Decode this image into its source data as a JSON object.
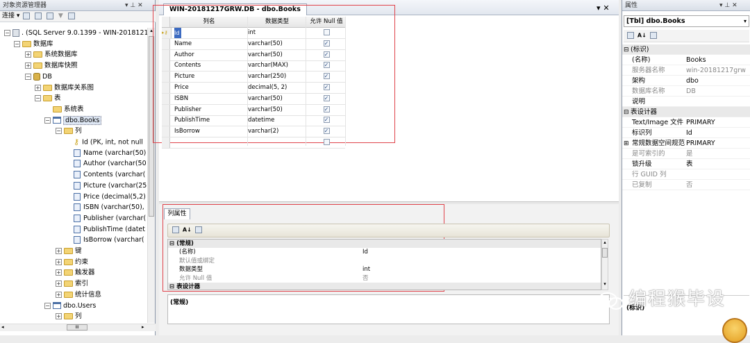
{
  "object_explorer": {
    "title": "对象资源管理器",
    "pin_label": "▾ ⊥ ✕",
    "connect_label": "连接",
    "tree": [
      {
        "label": ". (SQL Server 9.0.1399 - WIN-2018121",
        "level": 0,
        "icon": "server",
        "expander": "minus"
      },
      {
        "label": "数据库",
        "level": 1,
        "icon": "folder",
        "expander": "minus"
      },
      {
        "label": "系统数据库",
        "level": 2,
        "icon": "folder",
        "expander": "plus"
      },
      {
        "label": "数据库快照",
        "level": 2,
        "icon": "folder",
        "expander": "plus"
      },
      {
        "label": "DB",
        "level": 2,
        "icon": "database",
        "expander": "minus"
      },
      {
        "label": "数据库关系图",
        "level": 3,
        "icon": "folder",
        "expander": "plus"
      },
      {
        "label": "表",
        "level": 3,
        "icon": "folder",
        "expander": "minus"
      },
      {
        "label": "系统表",
        "level": 4,
        "icon": "folder",
        "expander": "none"
      },
      {
        "label": "dbo.Books",
        "level": 4,
        "icon": "table",
        "expander": "minus",
        "selected": true
      },
      {
        "label": "列",
        "level": 5,
        "icon": "folder",
        "expander": "minus"
      },
      {
        "label": "Id (PK, int, not null",
        "level": 6,
        "icon": "key",
        "expander": "none"
      },
      {
        "label": "Name (varchar(50)",
        "level": 6,
        "icon": "column",
        "expander": "none"
      },
      {
        "label": "Author (varchar(50",
        "level": 6,
        "icon": "column",
        "expander": "none"
      },
      {
        "label": "Contents (varchar(",
        "level": 6,
        "icon": "column",
        "expander": "none"
      },
      {
        "label": "Picture (varchar(25",
        "level": 6,
        "icon": "column",
        "expander": "none"
      },
      {
        "label": "Price (decimal(5,2)",
        "level": 6,
        "icon": "column",
        "expander": "none"
      },
      {
        "label": "ISBN (varchar(50),",
        "level": 6,
        "icon": "column",
        "expander": "none"
      },
      {
        "label": "Publisher (varchar(",
        "level": 6,
        "icon": "column",
        "expander": "none"
      },
      {
        "label": "PublishTime (datet",
        "level": 6,
        "icon": "column",
        "expander": "none"
      },
      {
        "label": "IsBorrow (varchar(",
        "level": 6,
        "icon": "column",
        "expander": "none"
      },
      {
        "label": "键",
        "level": 5,
        "icon": "folder",
        "expander": "plus"
      },
      {
        "label": "约束",
        "level": 5,
        "icon": "folder",
        "expander": "plus"
      },
      {
        "label": "触发器",
        "level": 5,
        "icon": "folder",
        "expander": "plus"
      },
      {
        "label": "索引",
        "level": 5,
        "icon": "folder",
        "expander": "plus"
      },
      {
        "label": "统计信息",
        "level": 5,
        "icon": "folder",
        "expander": "plus"
      },
      {
        "label": "dbo.Users",
        "level": 4,
        "icon": "table",
        "expander": "minus"
      },
      {
        "label": "列",
        "level": 5,
        "icon": "folder",
        "expander": "plus"
      }
    ],
    "hscroll_label": "III"
  },
  "designer": {
    "tab_label": "WIN-20181217GRW.DB - dbo.Books",
    "close_label": "▾ ✕",
    "headers": {
      "name": "列名",
      "type": "数据类型",
      "null": "允许 Null 值"
    },
    "rows": [
      {
        "name": "Id",
        "type": "int",
        "null": false,
        "pk": true
      },
      {
        "name": "Name",
        "type": "varchar(50)",
        "null": true
      },
      {
        "name": "Author",
        "type": "varchar(50)",
        "null": true
      },
      {
        "name": "Contents",
        "type": "varchar(MAX)",
        "null": true
      },
      {
        "name": "Picture",
        "type": "varchar(250)",
        "null": true
      },
      {
        "name": "Price",
        "type": "decimal(5, 2)",
        "null": true
      },
      {
        "name": "ISBN",
        "type": "varchar(50)",
        "null": true
      },
      {
        "name": "Publisher",
        "type": "varchar(50)",
        "null": true
      },
      {
        "name": "PublishTime",
        "type": "datetime",
        "null": true
      },
      {
        "name": "IsBorrow",
        "type": "varchar(2)",
        "null": true
      },
      {
        "name": "",
        "type": "",
        "null": false
      }
    ]
  },
  "column_properties": {
    "tab_label": "列属性",
    "rows": [
      {
        "kind": "cat",
        "key": "⊟ (常规)",
        "value": ""
      },
      {
        "kind": "prop",
        "key": "(名称)",
        "value": "Id",
        "gray": false
      },
      {
        "kind": "prop",
        "key": "默认值或绑定",
        "value": "",
        "gray": true
      },
      {
        "kind": "prop",
        "key": "数据类型",
        "value": "int",
        "gray": false
      },
      {
        "kind": "prop",
        "key": "允许 Null 值",
        "value": "否",
        "gray": true
      },
      {
        "kind": "cat",
        "key": "⊟ 表设计器",
        "value": ""
      }
    ],
    "description_title": "(常规)"
  },
  "properties": {
    "title": "属性",
    "pin_label": "▾ ⊥ ✕",
    "object": "[Tbl] dbo.Books",
    "rows": [
      {
        "kind": "cat",
        "key": "(标识)",
        "value": "",
        "mark": "⊟"
      },
      {
        "kind": "prop",
        "key": "(名称)",
        "value": "Books",
        "gray": false
      },
      {
        "kind": "prop",
        "key": "服务器名称",
        "value": "win-20181217grw",
        "gray": true
      },
      {
        "kind": "prop",
        "key": "架构",
        "value": "dbo",
        "gray": false
      },
      {
        "kind": "prop",
        "key": "数据库名称",
        "value": "DB",
        "gray": true
      },
      {
        "kind": "prop",
        "key": "说明",
        "value": "",
        "gray": false
      },
      {
        "kind": "cat",
        "key": "表设计器",
        "value": "",
        "mark": "⊟"
      },
      {
        "kind": "prop",
        "key": "Text/Image 文件",
        "value": "PRIMARY",
        "gray": false
      },
      {
        "kind": "prop",
        "key": "标识列",
        "value": "Id",
        "gray": false
      },
      {
        "kind": "prop",
        "key": "常规数据空间规范",
        "value": "PRIMARY",
        "gray": false,
        "mark": "⊞"
      },
      {
        "kind": "prop",
        "key": "是可索引的",
        "value": "是",
        "gray": true
      },
      {
        "kind": "prop",
        "key": "锁升级",
        "value": "表",
        "gray": false
      },
      {
        "kind": "prop",
        "key": "行 GUID 列",
        "value": "",
        "gray": true
      },
      {
        "kind": "prop",
        "key": "已复制",
        "value": "否",
        "gray": true
      }
    ],
    "description_title": "(标识)"
  },
  "watermark": "编程猴毕设",
  "colors": {
    "highlight_box": "#e0434b",
    "selection": "#dde6f3"
  }
}
